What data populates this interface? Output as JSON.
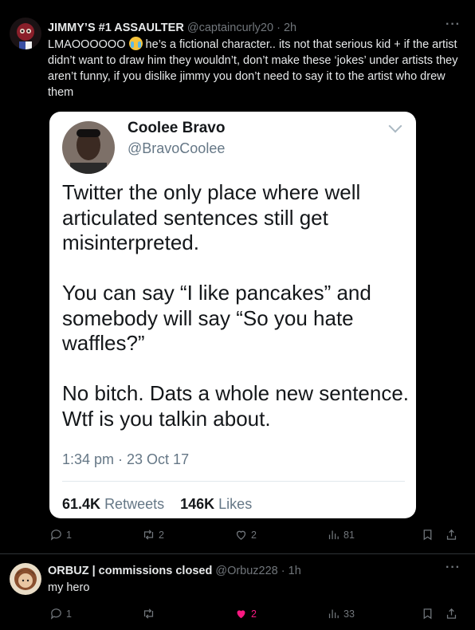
{
  "tweets": [
    {
      "author_name": "JIMMY’S #1 ASSAULTER",
      "handle": "@captaincurly20",
      "time": "2h",
      "text_before_emoji": "LMAOOOOOO",
      "text_after_emoji": " he’s a fictional character.. its not that serious kid + if the artist didn’t want to draw him they wouldn’t, don’t make these ‘jokes’ under artists they aren’t funny, if you dislike jimmy you don’t need to say it to the artist who drew them",
      "emoji": "loudly-crying-face",
      "replies": "1",
      "retweets": "2",
      "likes": "2",
      "views": "81",
      "embedded": {
        "name": "Coolee Bravo",
        "handle": "@BravoCoolee",
        "paragraphs": [
          "Twitter the only place where well articulated sentences still get misinterpreted.",
          "You can say “I like pancakes” and somebody will say “So you hate waffles?”",
          "No bitch. Dats a whole new sentence. Wtf is you talkin about."
        ],
        "timestamp": "1:34 pm · 23 Oct 17",
        "retweets_count": "61.4K",
        "retweets_label": "Retweets",
        "likes_count": "146K",
        "likes_label": "Likes"
      }
    },
    {
      "author_name": "ORBUZ | commissions closed",
      "handle": "@Orbuz228",
      "time": "1h",
      "text": "my hero",
      "replies": "1",
      "retweets": "",
      "likes": "2",
      "views": "33"
    }
  ],
  "colors": {
    "background": "#000000",
    "muted": "#71767b",
    "like": "#f91880",
    "card": "#ffffff"
  }
}
